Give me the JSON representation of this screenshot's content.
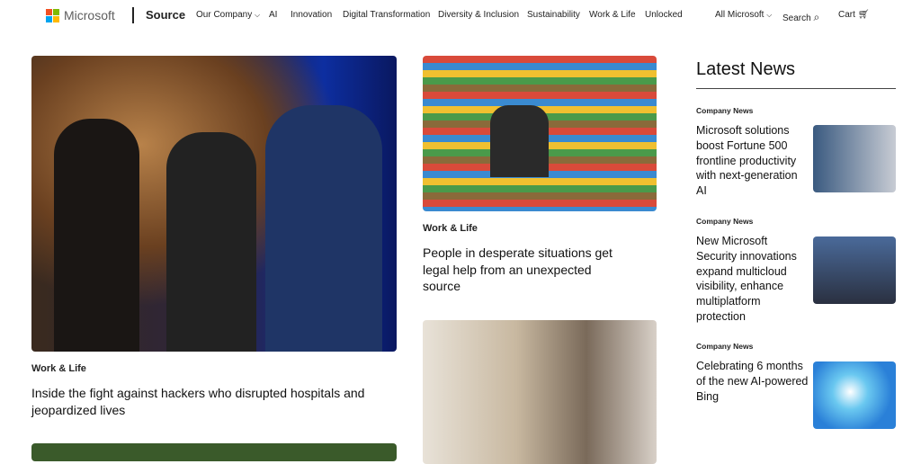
{
  "header": {
    "logo_text": "Microsoft",
    "site": "Source",
    "nav": [
      "Our Company",
      "AI",
      "Innovation",
      "Digital Transformation",
      "Diversity & Inclusion",
      "Sustainability",
      "Work & Life",
      "Unlocked"
    ],
    "all_microsoft": "All Microsoft",
    "search": "Search",
    "cart": "Cart",
    "logo_colors": [
      "#f25022",
      "#7fba00",
      "#00a4ef",
      "#ffb900"
    ]
  },
  "main": {
    "feature": {
      "category": "Work & Life",
      "title": "Inside the fight against hackers who disrupted hospitals and jeopardized lives"
    },
    "second": {
      "category": "Work & Life",
      "title": "People in desperate situations get legal help from an unexpected source"
    }
  },
  "latest": {
    "heading": "Latest News",
    "items": [
      {
        "category": "Company News",
        "title": "Microsoft solutions boost Fortune 500 frontline productivity with next-generation AI"
      },
      {
        "category": "Company News",
        "title": "New Microsoft Security innovations expand multicloud visibility, enhance multiplatform protection"
      },
      {
        "category": "Company News",
        "title": "Celebrating 6 months of the new AI-powered Bing"
      }
    ]
  }
}
